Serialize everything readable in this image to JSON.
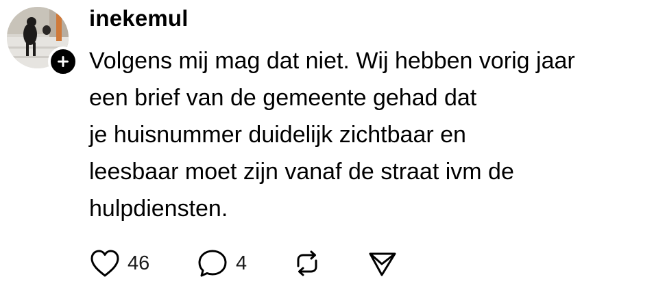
{
  "post": {
    "username": "inekemul",
    "text_lines": [
      "Volgens mij mag dat niet. Wij hebben vorig jaar",
      "een brief van de gemeente gehad dat",
      "je huisnummer duidelijk zichtbaar en",
      "leesbaar moet zijn vanaf de straat ivm de",
      "hulpdiensten."
    ],
    "actions": {
      "like": {
        "icon": "heart-icon",
        "count": "46"
      },
      "reply": {
        "icon": "speech-bubble-icon",
        "count": "4"
      },
      "repost": {
        "icon": "repost-icon"
      },
      "share": {
        "icon": "send-icon"
      }
    },
    "follow_badge": {
      "icon": "plus-icon"
    }
  }
}
